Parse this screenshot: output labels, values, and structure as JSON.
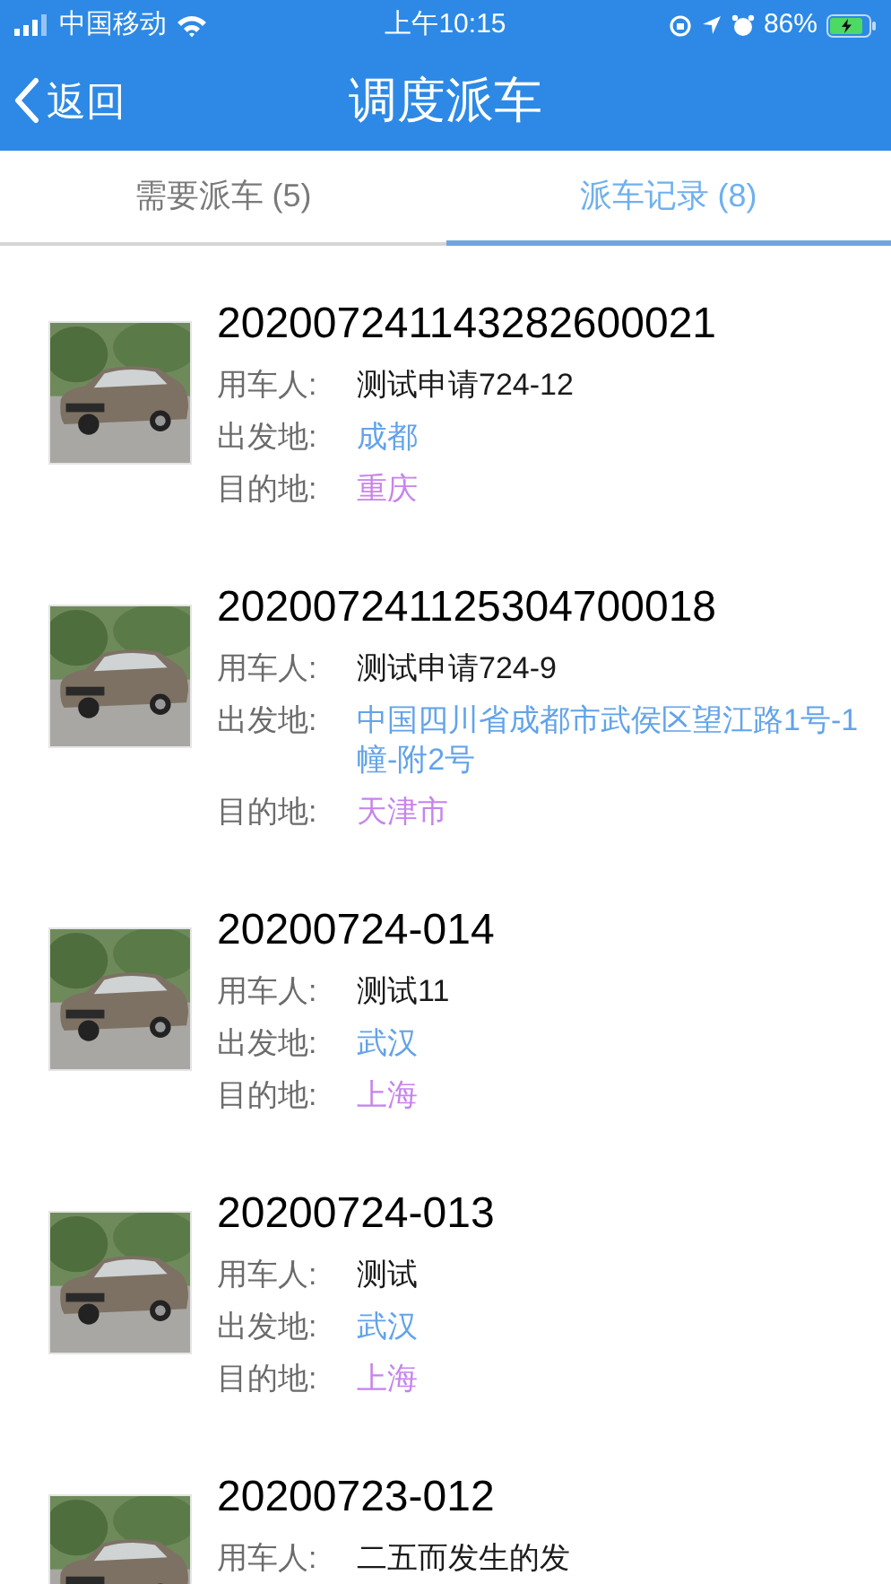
{
  "status_bar": {
    "carrier": "中国移动",
    "time": "上午10:15",
    "battery": "86%"
  },
  "nav": {
    "back": "返回",
    "title": "调度派车"
  },
  "tabs": [
    {
      "label": "需要派车 (5)",
      "selected": false
    },
    {
      "label": "派车记录 (8)",
      "selected": true
    }
  ],
  "records": [
    {
      "number": "202007241143282600021",
      "fields": [
        {
          "kind": "person",
          "label": "用车人:",
          "value": "测试申请724-12"
        },
        {
          "kind": "origin",
          "label": "出发地:",
          "value": "成都"
        },
        {
          "kind": "destination",
          "label": "目的地:",
          "value": "重庆"
        }
      ]
    },
    {
      "number": "202007241125304700018",
      "fields": [
        {
          "kind": "person",
          "label": "用车人:",
          "value": "测试申请724-9"
        },
        {
          "kind": "origin",
          "label": "出发地:",
          "value": "中国四川省成都市武侯区望江路1号-1幢-附2号"
        },
        {
          "kind": "destination",
          "label": "目的地:",
          "value": "天津市"
        }
      ]
    },
    {
      "number": "20200724-014",
      "fields": [
        {
          "kind": "person",
          "label": "用车人:",
          "value": "测试11"
        },
        {
          "kind": "origin",
          "label": "出发地:",
          "value": "武汉"
        },
        {
          "kind": "destination",
          "label": "目的地:",
          "value": "上海"
        }
      ]
    },
    {
      "number": "20200724-013",
      "fields": [
        {
          "kind": "person",
          "label": "用车人:",
          "value": "测试"
        },
        {
          "kind": "origin",
          "label": "出发地:",
          "value": "武汉"
        },
        {
          "kind": "destination",
          "label": "目的地:",
          "value": "上海"
        }
      ]
    },
    {
      "number": "20200723-012",
      "fields": [
        {
          "kind": "person",
          "label": "用车人:",
          "value": "二五而发生的发"
        }
      ]
    }
  ]
}
